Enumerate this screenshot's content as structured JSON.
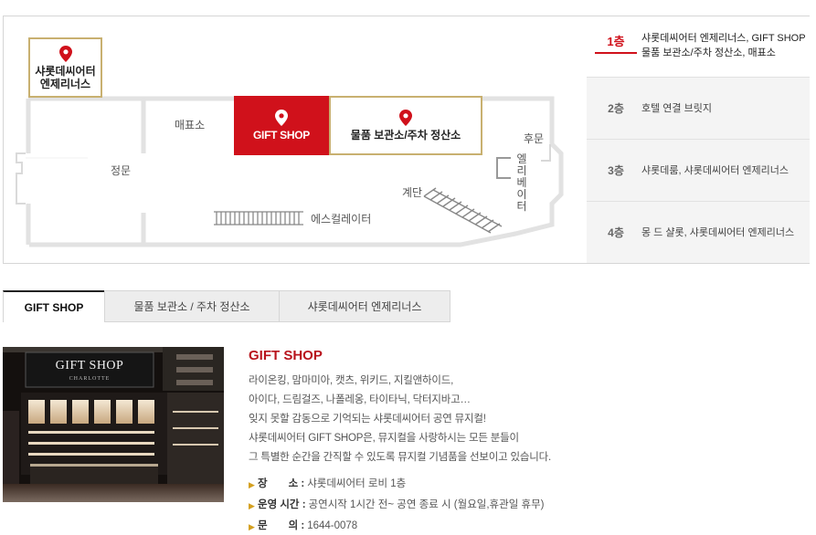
{
  "map": {
    "labels": {
      "entrance": "정문",
      "shop_stand": "매표소",
      "back_gate": "후문",
      "elevator": "엘리베이터",
      "stairs": "계단",
      "escalator": "에스컬레이터"
    },
    "rooms": {
      "gift": "GIFT SHOP",
      "storage": "물품 보관소/주차 정산소",
      "theater_line1": "샤롯데씨어터",
      "theater_line2": "엔제리너스"
    },
    "floors": [
      {
        "num": "1층",
        "desc_line1": "샤롯데씨어터 엔제리너스, GIFT SHOP",
        "desc_line2": "물품 보관소/주차 정산소, 매표소"
      },
      {
        "num": "2층",
        "desc_line1": "호텔 연결 브릿지",
        "desc_line2": ""
      },
      {
        "num": "3층",
        "desc_line1": "샤롯데룸, 샤롯데씨어터 엔제리너스",
        "desc_line2": ""
      },
      {
        "num": "4층",
        "desc_line1": "몽 드 샬롯, 샤롯데씨어터 엔제리너스",
        "desc_line2": ""
      }
    ]
  },
  "tabs": [
    "GIFT SHOP",
    "물품 보관소 / 주차 정산소",
    "샤롯데씨어터 엔제리너스"
  ],
  "active_tab": 0,
  "photo": {
    "sign_text": "GIFT SHOP",
    "sign_subtext": "CHARLOTTE"
  },
  "detail": {
    "title": "GIFT SHOP",
    "paragraphs": [
      "라이온킹, 맘마미아, 캣츠, 위키드, 지킬앤하이드,",
      "아이다, 드림걸즈, 나폴레옹, 타이타닉, 닥터지바고…",
      "잊지 못할 감동으로 기억되는 샤롯데씨어터 공연 뮤지컬!",
      "샤롯데씨어터 GIFT SHOP은, 뮤지컬을 사랑하시는 모든 분들이",
      "그 특별한 순간을 간직할 수 있도록 뮤지컬 기념품을 선보이고 있습니다."
    ],
    "infos": [
      {
        "key": "장　　소 :",
        "value": "샤롯데씨어터 로비 1층"
      },
      {
        "key": "운영 시간 :",
        "value": "공연시작 1시간 전~ 공연 종료 시 (월요일,휴관일 휴무)"
      },
      {
        "key": "문　　의 :",
        "value": "1644-0078"
      }
    ]
  },
  "colors": {
    "accent": "#d0111b",
    "highlight_border": "#c8b070",
    "title_red": "#b8141d"
  }
}
